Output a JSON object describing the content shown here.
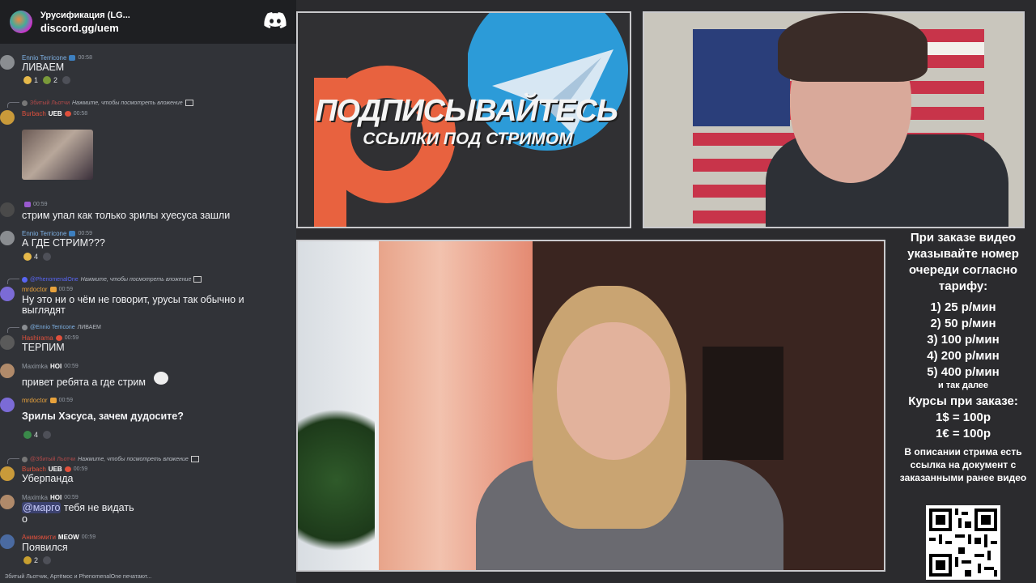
{
  "chat": {
    "server_name": "Урусификация (LG...",
    "invite": "discord.gg/uem",
    "messages": [
      {
        "user": "Ennio Terricone",
        "time": "00:58",
        "text": "ЛИВАЕМ",
        "reactions": [
          "1",
          "2"
        ]
      },
      {
        "reply_user": "Збитый Льотчи",
        "reply_text": "Нажмите, чтобы посмотреть вложение",
        "user": "Burbach",
        "tag": "UEB",
        "time": "00:58",
        "text": ""
      },
      {
        "user": "",
        "time": "00:59",
        "text": "стрим упал как только зрилы хуесуса зашли"
      },
      {
        "user": "Ennio Terricone",
        "time": "00:59",
        "text": "А ГДЕ СТРИМ???",
        "reactions": [
          "4"
        ]
      },
      {
        "reply_user": "@PhenomenalOne",
        "reply_text": "Нажмите, чтобы посмотреть вложение",
        "user": "mrdoctor",
        "time": "00:59",
        "text_lines": [
          "Ну это ни о чём не говорит, урусы так обычно и",
          "выглядят"
        ]
      },
      {
        "reply_user": "@Ennio Terricone",
        "reply_text": "ЛИВАЕМ",
        "user": "Hashirama",
        "time": "00:59",
        "text": "ТЕРПИМ"
      },
      {
        "user": "Maximka",
        "tag": "HOI",
        "time": "00:59",
        "text": "привет ребята а где стрим"
      },
      {
        "user": "mrdoctor",
        "time": "00:59",
        "text": "Зрилы Хэсуса, зачем дудосите?",
        "reactions": [
          "4"
        ]
      },
      {
        "reply_user": "@Збитый Льотчи",
        "reply_text": "Нажмите, чтобы посмотреть вложение",
        "user": "Burbach",
        "tag": "UEB",
        "time": "00:59",
        "text": "Уберпанда"
      },
      {
        "user": "Maximka",
        "tag": "HOI",
        "time": "00:59",
        "mention": "@марго",
        "text": " тебя не видать",
        "text2": "о"
      },
      {
        "user": "Анимэмити",
        "tag": "MEOW",
        "time": "00:59",
        "text": "Появился",
        "reactions": [
          "2"
        ]
      }
    ],
    "typing": "Збитый Льотчик, Артёмос и PhenomenalOne печатают..."
  },
  "promo": {
    "headline": "ПОДПИСЫВАЙТЕСЬ",
    "subline": "ССЫЛКИ ПОД СТРИМОМ"
  },
  "info": {
    "order_text": "При заказе видео указывайте номер очереди согласно тарифу:",
    "tariffs": [
      "1) 25 р/мин",
      "2) 50 р/мин",
      "3) 100 р/мин",
      "4) 200 р/мин",
      "5) 400 р/мин"
    ],
    "etc": "и так далее",
    "rates_title": "Курсы при заказе:",
    "rates": [
      "1$ = 100р",
      "1€ = 100р"
    ],
    "desc_text": "В описании стрима есть ссылка на документ с заказанными ранее видео"
  },
  "colors": {
    "discord_blurple": "#5865f2",
    "chat_bg": "#313338",
    "patreon": "#e8623f",
    "telegram": "#2c9bd8"
  }
}
